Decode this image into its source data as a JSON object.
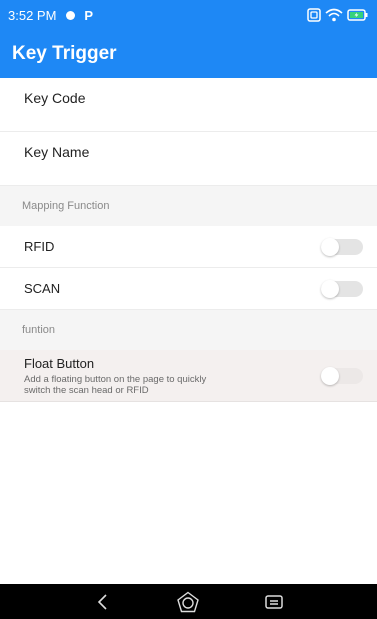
{
  "status_bar": {
    "time": "3:52 PM",
    "p_letter": "P"
  },
  "app_bar": {
    "title": "Key Trigger"
  },
  "fields": [
    {
      "label": "Key Code"
    },
    {
      "label": "Key Name"
    }
  ],
  "sections": {
    "mapping": {
      "title": "Mapping Function"
    },
    "function": {
      "title": "funtion"
    }
  },
  "toggles": {
    "rfid": {
      "label": "RFID",
      "checked": false
    },
    "scan": {
      "label": "SCAN",
      "checked": false
    },
    "float": {
      "label": "Float Button",
      "description": "Add a floating button on the page to quickly switch the scan head or RFID",
      "checked": false
    }
  },
  "colors": {
    "accent": "#1e88f5"
  },
  "icons": {
    "status": [
      "status-dot-icon",
      "p-icon",
      "nfc-icon",
      "wifi-icon",
      "battery-charging-icon"
    ],
    "nav": [
      "back-icon",
      "home-icon",
      "recent-apps-icon"
    ]
  }
}
